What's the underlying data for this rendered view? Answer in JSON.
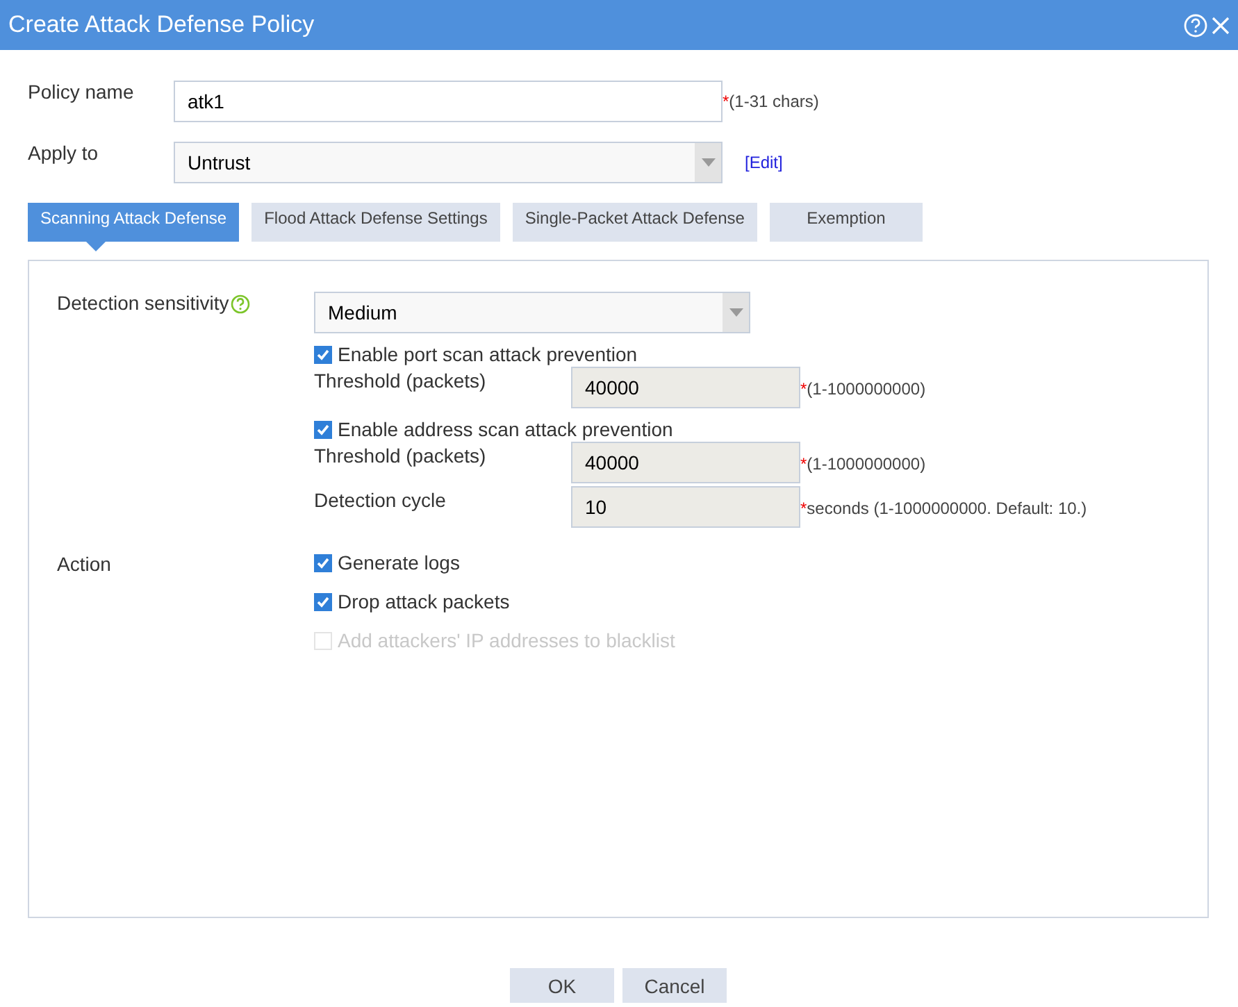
{
  "window": {
    "title": "Create Attack Defense Policy"
  },
  "fields": [
    {
      "kind": "text",
      "label": "Policy name",
      "value": "atk1",
      "mark": "*",
      "hint": "(1-31 chars)"
    },
    {
      "kind": "select",
      "label": "Apply to",
      "value": "Untrust",
      "link": "[Edit]"
    }
  ],
  "tabs": [
    {
      "label": "Scanning Attack Defense",
      "selected": true
    },
    {
      "label": "Flood Attack Defense Settings",
      "selected": false
    },
    {
      "label": "Single-Packet Attack Defense",
      "selected": false
    },
    {
      "label": "Exemption",
      "selected": false
    }
  ],
  "sensitivity": {
    "label": "Detection sensitivity",
    "value": "Medium"
  },
  "scan_options": [
    {
      "kind": "checkbox",
      "label": "Enable port scan attack prevention",
      "checked": true,
      "disabled": false
    },
    {
      "kind": "number",
      "label": "Threshold (packets)",
      "value": "40000",
      "mark": "*",
      "hint": "(1-1000000000)"
    },
    {
      "kind": "checkbox",
      "label": "Enable address scan attack prevention",
      "checked": true,
      "disabled": false
    },
    {
      "kind": "number",
      "label": "Threshold (packets)",
      "value": "40000",
      "mark": "*",
      "hint": "(1-1000000000)"
    },
    {
      "kind": "number",
      "label": "Detection cycle",
      "value": "10",
      "mark": "*",
      "hint": "seconds (1-1000000000. Default: 10.)"
    }
  ],
  "action": {
    "label": "Action",
    "options": [
      {
        "label": "Generate logs",
        "checked": true,
        "disabled": false
      },
      {
        "label": "Drop attack packets",
        "checked": true,
        "disabled": false
      },
      {
        "label": "Add attackers' IP addresses to blacklist",
        "checked": false,
        "disabled": true
      }
    ]
  },
  "buttons": [
    "OK",
    "Cancel"
  ]
}
